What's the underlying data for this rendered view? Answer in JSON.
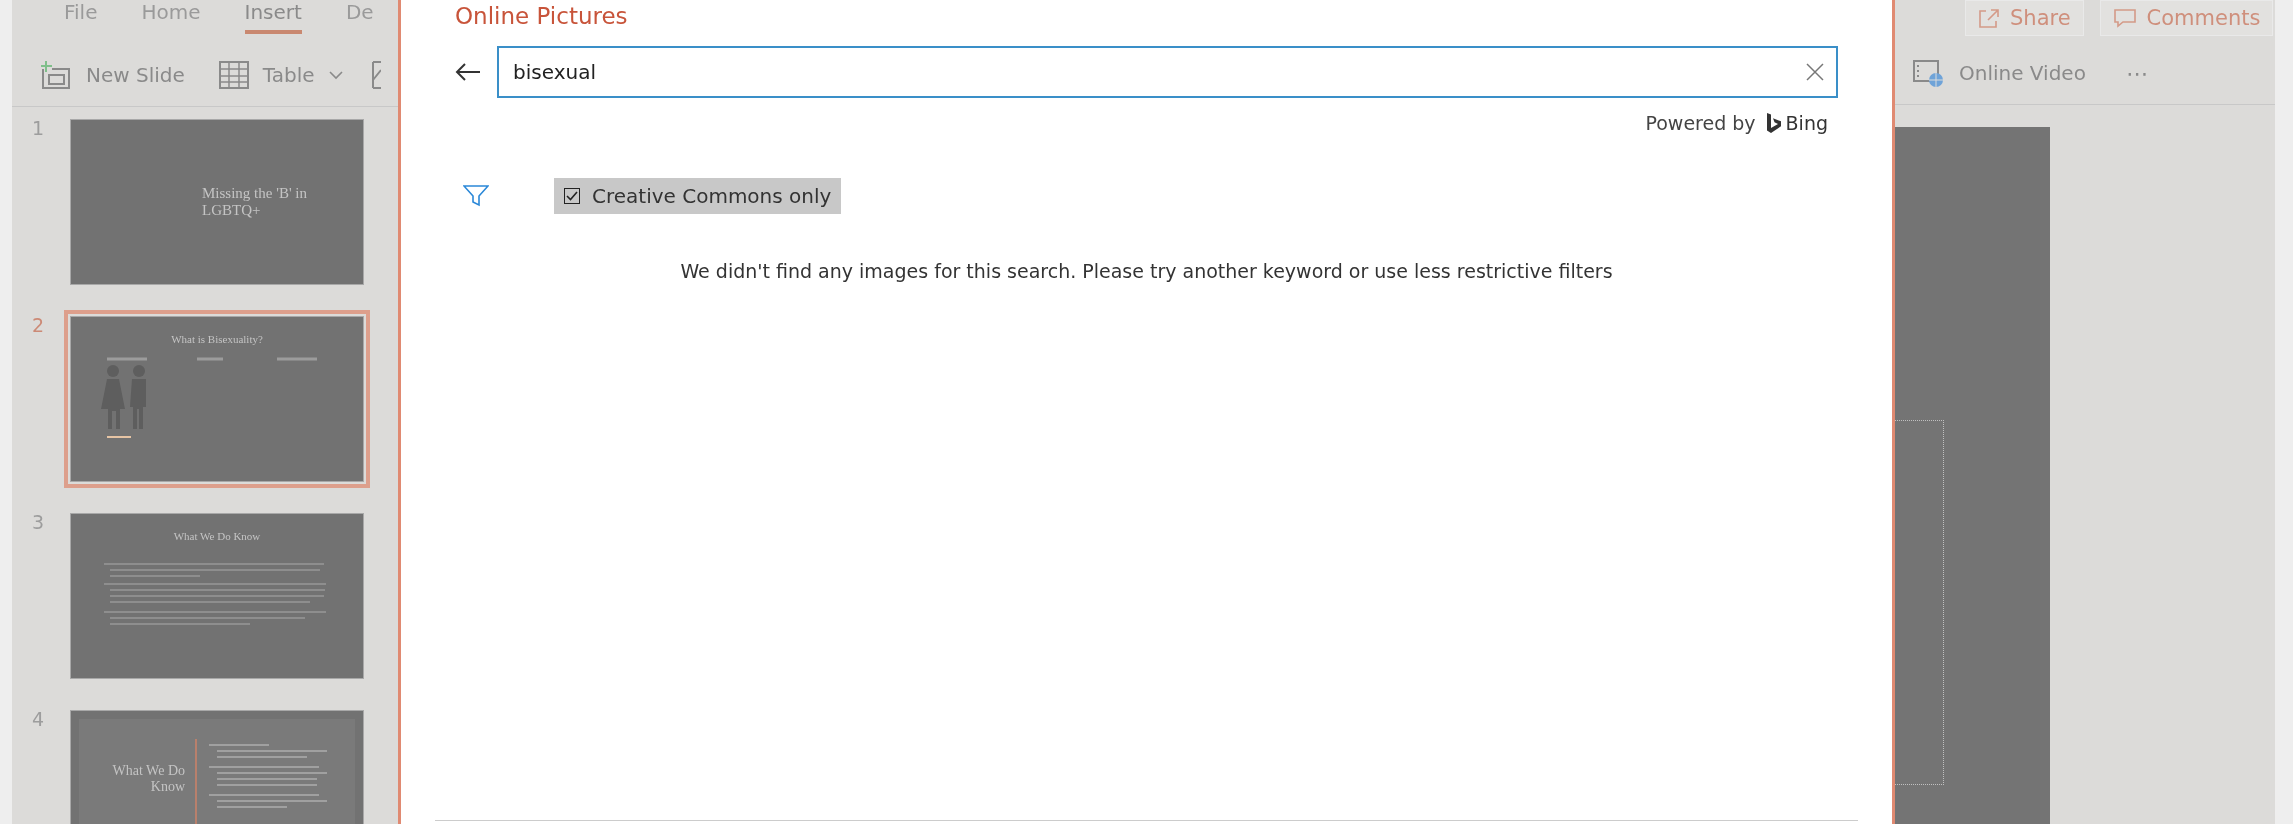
{
  "ribbon": {
    "tabs": [
      {
        "label": "File",
        "selected": false
      },
      {
        "label": "Home",
        "selected": false
      },
      {
        "label": "Insert",
        "selected": true
      },
      {
        "label": "De",
        "selected": false
      }
    ]
  },
  "toolbar_left": [
    {
      "kind": "new-slide",
      "label": "New Slide"
    },
    {
      "kind": "table",
      "label": "Table"
    }
  ],
  "slides": [
    {
      "number": "1",
      "selected": false,
      "kind": "title",
      "title": "Missing the 'B' in LGBTQ+"
    },
    {
      "number": "2",
      "selected": true,
      "kind": "figures",
      "title": "What is Bisexuality?"
    },
    {
      "number": "3",
      "selected": false,
      "kind": "bullets",
      "title": "What We Do Know"
    },
    {
      "number": "4",
      "selected": false,
      "kind": "split",
      "title": "What We Do Know"
    }
  ],
  "dialog": {
    "title": "Online Pictures",
    "search": {
      "value": "bisexual"
    },
    "attribution": {
      "prefix": "Powered by",
      "brand": "Bing"
    },
    "filter": {
      "label": "Creative Commons only",
      "checked": true
    },
    "message": "We didn't find any images for this search. Please try another keyword or use less restrictive filters"
  },
  "header_buttons": [
    {
      "kind": "share",
      "label": "Share"
    },
    {
      "kind": "comments",
      "label": "Comments"
    }
  ],
  "toolbar_right": [
    {
      "kind": "online-video",
      "label": "Online Video"
    },
    {
      "kind": "more",
      "label": "⋯"
    }
  ]
}
